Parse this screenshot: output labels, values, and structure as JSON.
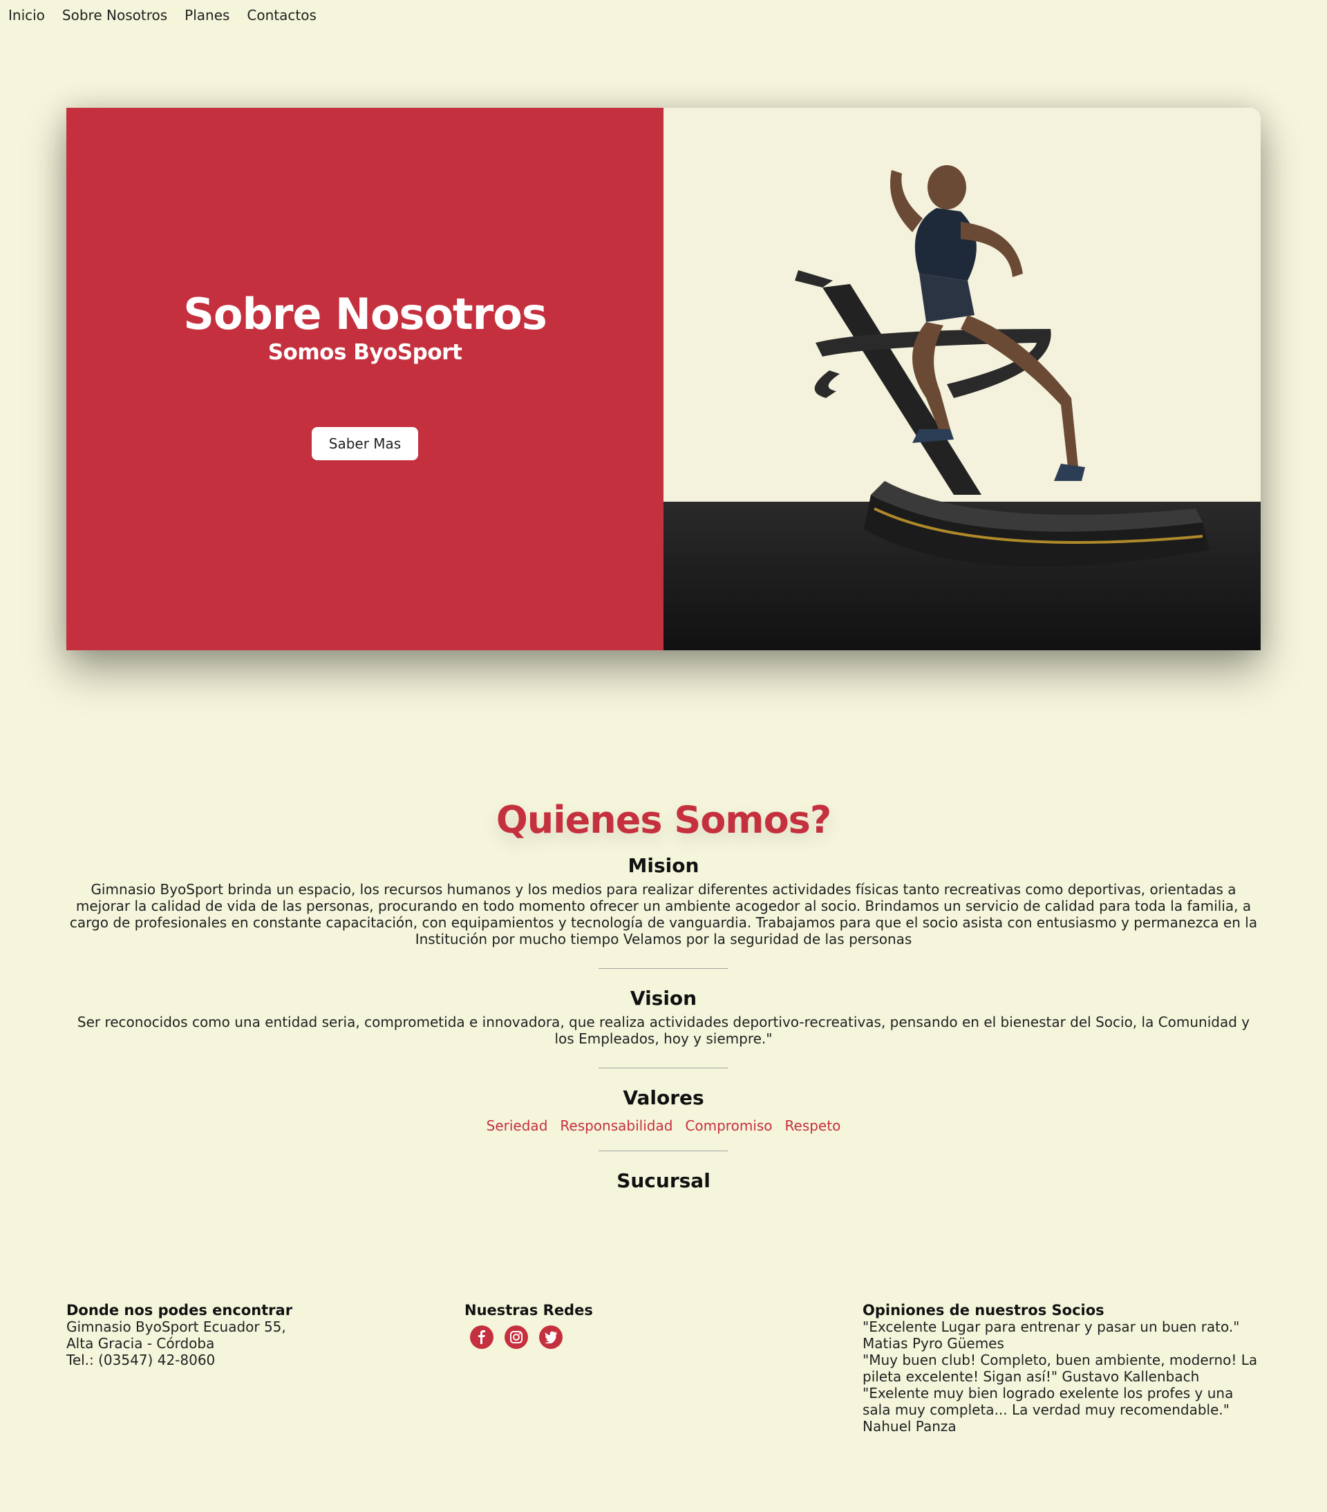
{
  "nav": {
    "items": [
      "Inicio",
      "Sobre Nosotros",
      "Planes",
      "Contactos"
    ]
  },
  "hero": {
    "title": "Sobre Nosotros",
    "subtitle": "Somos ByoSport",
    "button_label": "Saber Mas",
    "image": "man-running-on-curved-treadmill"
  },
  "about": {
    "title": "Quienes Somos?",
    "mision": {
      "heading": "Mision",
      "text": "Gimnasio ByoSport brinda un espacio, los recursos humanos y los medios para realizar diferentes actividades físicas tanto recreativas como deportivas, orientadas a mejorar la calidad de vida de las personas, procurando en todo momento ofrecer un ambiente acogedor al socio. Brindamos un servicio de calidad para toda la familia, a cargo de profesionales en constante capacitación, con equipamientos y tecnología de vanguardia. Trabajamos para que el socio asista con entusiasmo y permanezca en la Institución por mucho tiempo Velamos por la seguridad de las personas"
    },
    "vision": {
      "heading": "Vision",
      "text": "Ser reconocidos como una entidad seria, comprometida e innovadora, que realiza actividades deportivo-recreativas, pensando en el bienestar del Socio, la Comunidad y los Empleados, hoy y siempre.\""
    },
    "valores": {
      "heading": "Valores",
      "items": [
        "Seriedad",
        "Responsabilidad",
        "Compromiso",
        "Respeto"
      ]
    },
    "sucursal": {
      "heading": "Sucursal"
    }
  },
  "footer": {
    "location": {
      "heading": "Donde nos podes encontrar",
      "line1": "Gimnasio ByoSport Ecuador 55,",
      "line2": "Alta Gracia - Córdoba",
      "line3": "Tel.: (03547) 42-8060"
    },
    "social": {
      "heading": "Nuestras Redes",
      "icons": [
        "facebook-icon",
        "instagram-icon",
        "twitter-icon"
      ]
    },
    "opinions": {
      "heading": "Opiniones de nuestros Socios",
      "items": [
        "\"Excelente Lugar para entrenar y pasar un buen rato.\" Matias Pyro Güemes",
        "\"Muy buen club! Completo, buen ambiente, moderno! La pileta excelente! Sigan así!\" Gustavo Kallenbach",
        "\"Exelente muy bien logrado exelente los profes y una sala muy completa... La verdad muy recomendable.\" Nahuel Panza"
      ]
    }
  },
  "colors": {
    "background": "#f5f5dc",
    "accent": "#c5303e"
  }
}
